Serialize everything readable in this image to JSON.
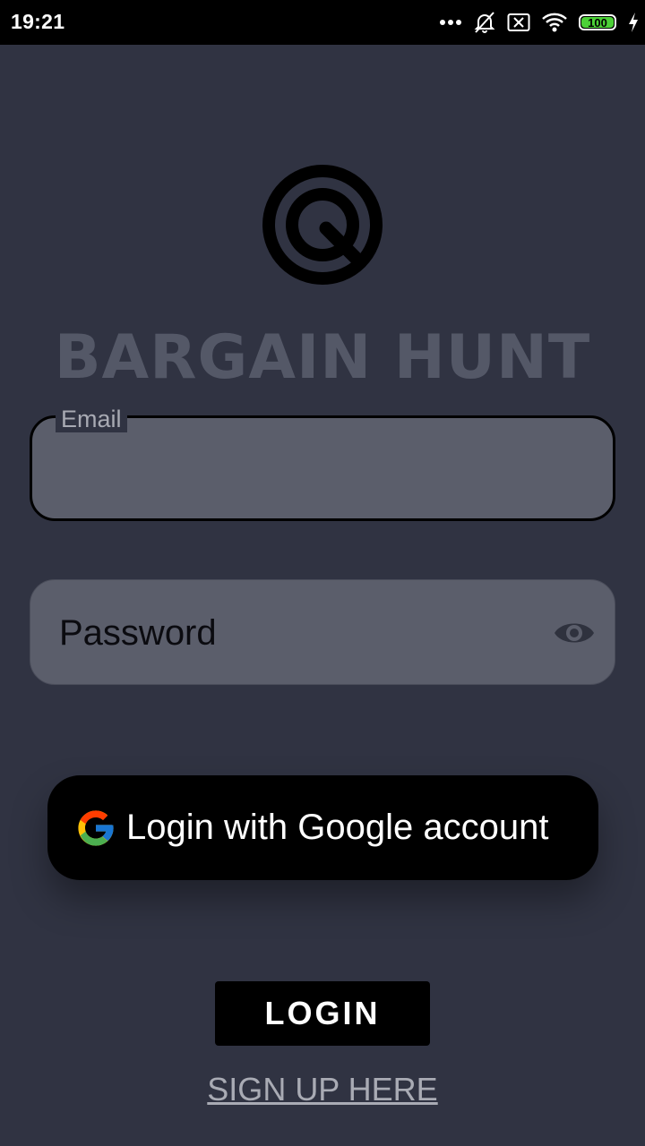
{
  "status_bar": {
    "time": "19:21",
    "battery_level": "100",
    "icons": [
      "more-dots-icon",
      "alarm-off-icon",
      "sim-off-icon",
      "wifi-icon",
      "battery-icon",
      "charging-icon"
    ]
  },
  "app": {
    "title": "BARGAIN HUNT",
    "logo_icon": "target-search-icon"
  },
  "form": {
    "email_label": "Email",
    "email_value": "",
    "password_placeholder": "Password",
    "password_value": "",
    "visibility_icon": "eye-icon"
  },
  "buttons": {
    "google_login_label": "Login with Google account",
    "login_label": "LOGIN",
    "signup_label": "SIGN UP HERE"
  },
  "colors": {
    "background": "#303342",
    "field_fill": "#5b5e6b",
    "title": "#545867",
    "battery": "#4cd137"
  }
}
